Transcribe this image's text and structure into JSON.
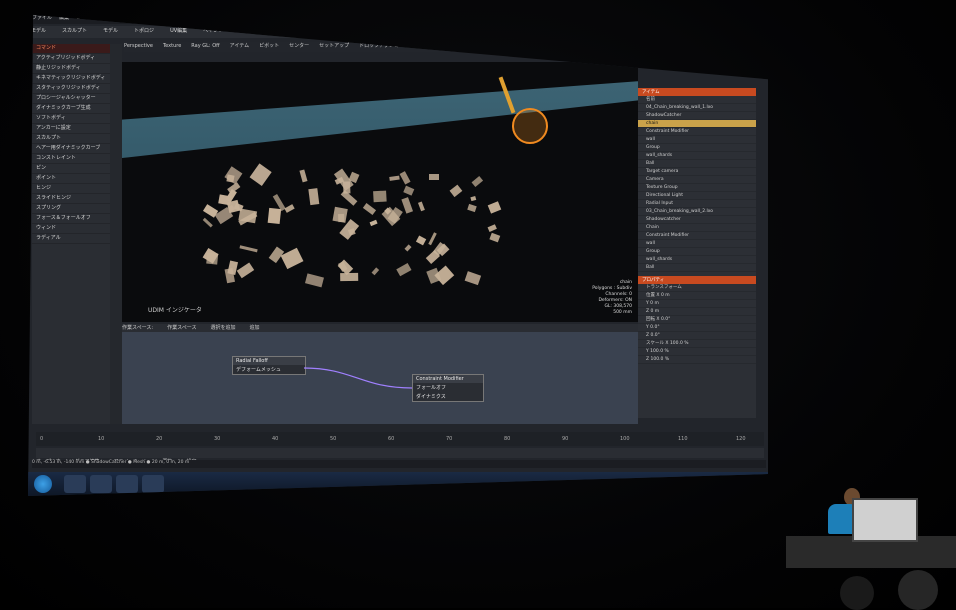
{
  "screen": {
    "menubar": [
      "ファイル",
      "編集",
      "ビュー",
      "選択",
      "アイテム",
      "形状",
      "ラクスチャ",
      "頂点マップ",
      "アニメーション",
      "ダイナミクス",
      "レンダー",
      "レイアウト",
      "システム",
      "ヘルプ"
    ],
    "tabs": [
      "モデル",
      "スカルプト",
      "モデル",
      "トポロジ",
      "UV編集",
      "ペイント",
      "レイアウト",
      "セットアップ",
      "アニメーション",
      "レンダー",
      "スクリプト",
      "スケマティックFusion"
    ],
    "active_tab": "セットアップ",
    "viewport_toolbar": [
      "Perspective",
      "Texture",
      "Ray GL: Off",
      "アイテム",
      "ピボット",
      "センター",
      "セットアップ",
      "ドロップアクション",
      "(none)",
      "ワールド",
      "ローカル",
      "アクションセンター",
      "対称",
      "スナッピング",
      "作業平面"
    ],
    "left_panel": {
      "header": "コマンド",
      "items": [
        "アクティブリジッドボディ",
        "静止リジッドボディ",
        "キネマティックリジッドボディ",
        "スタティックリジッドボディ",
        "プロシージャルシャッター",
        "ダイナミックカーブ生成",
        "ソフトボディ",
        "アンカーに設定",
        "スカルプト",
        "ヘアー用ダイナミックカーブ",
        "コンストレイント",
        "ピン",
        "ポイント",
        "ヒンジ",
        "スライドヒンジ",
        "スプリング",
        "フォース＆フォールオフ",
        "ウィンド",
        "ラディアル"
      ]
    },
    "viewport_label": "UDIM インジケータ",
    "viewport_info": [
      "chain",
      "Polygons : Subdiv",
      "Channels: 0",
      "Deformers: ON",
      "GL: 308,570",
      "500 mm"
    ],
    "right_panel": {
      "header": "アイテム",
      "items": [
        "名前",
        "04_Chain_breaking_wall_1.lxo",
        "ShadowCatcher",
        "chain",
        "Constraint Modifier",
        "wall",
        "Group",
        "wall_shards",
        "Ball",
        "Target camera",
        "Camera",
        "Texture Group",
        "Directional Light",
        "Radial Input",
        "03_Chain_breaking_wall_2.lxo",
        "Shadowcatcher",
        "Chain",
        "Constraint Modifier",
        "wall",
        "Group",
        "wall_shards",
        "Ball"
      ],
      "selected": "chain",
      "properties_header": "プロパティ",
      "properties": [
        "トランスフォーム",
        "位置 X 0 m",
        "Y 0 m",
        "Z 0 m",
        "回転 X 0.0°",
        "Y 0.0°",
        "Z 0.0°",
        "スケール X 100.0 %",
        "Y 100.0 %",
        "Z 100.0 %"
      ]
    },
    "schematic_toolbar": [
      "作業スペース:",
      "作業スペース",
      "選択を追加",
      "追加"
    ],
    "nodes": [
      {
        "title": "Radial Falloff",
        "ports": [
          "デフォームメッシュ"
        ]
      },
      {
        "title": "Constraint Modifier",
        "ports": [
          "フォールオフ",
          "ダイナミクス"
        ]
      }
    ],
    "timeline_ticks": [
      "0",
      "10",
      "20",
      "30",
      "40",
      "50",
      "60",
      "70",
      "80",
      "90",
      "100",
      "110",
      "120"
    ],
    "transport": [
      "オーディオ",
      "グラフ編集",
      "アニメーション",
      "再生",
      "設定"
    ],
    "status_text": "0 m, -6.53 m, -140 mm ● ShadowCatcher ● Mesh ● 20 m, 0 m, 20 m",
    "taskbar_items": [
      "start",
      "ie",
      "explorer",
      "media",
      "modo"
    ]
  },
  "colors": {
    "accent": "#e07020",
    "viewport_floor": "#3e6676",
    "ball": "#f08a20",
    "panel": "#2a2d33",
    "presenter_shirt": "#1d7fb8"
  }
}
